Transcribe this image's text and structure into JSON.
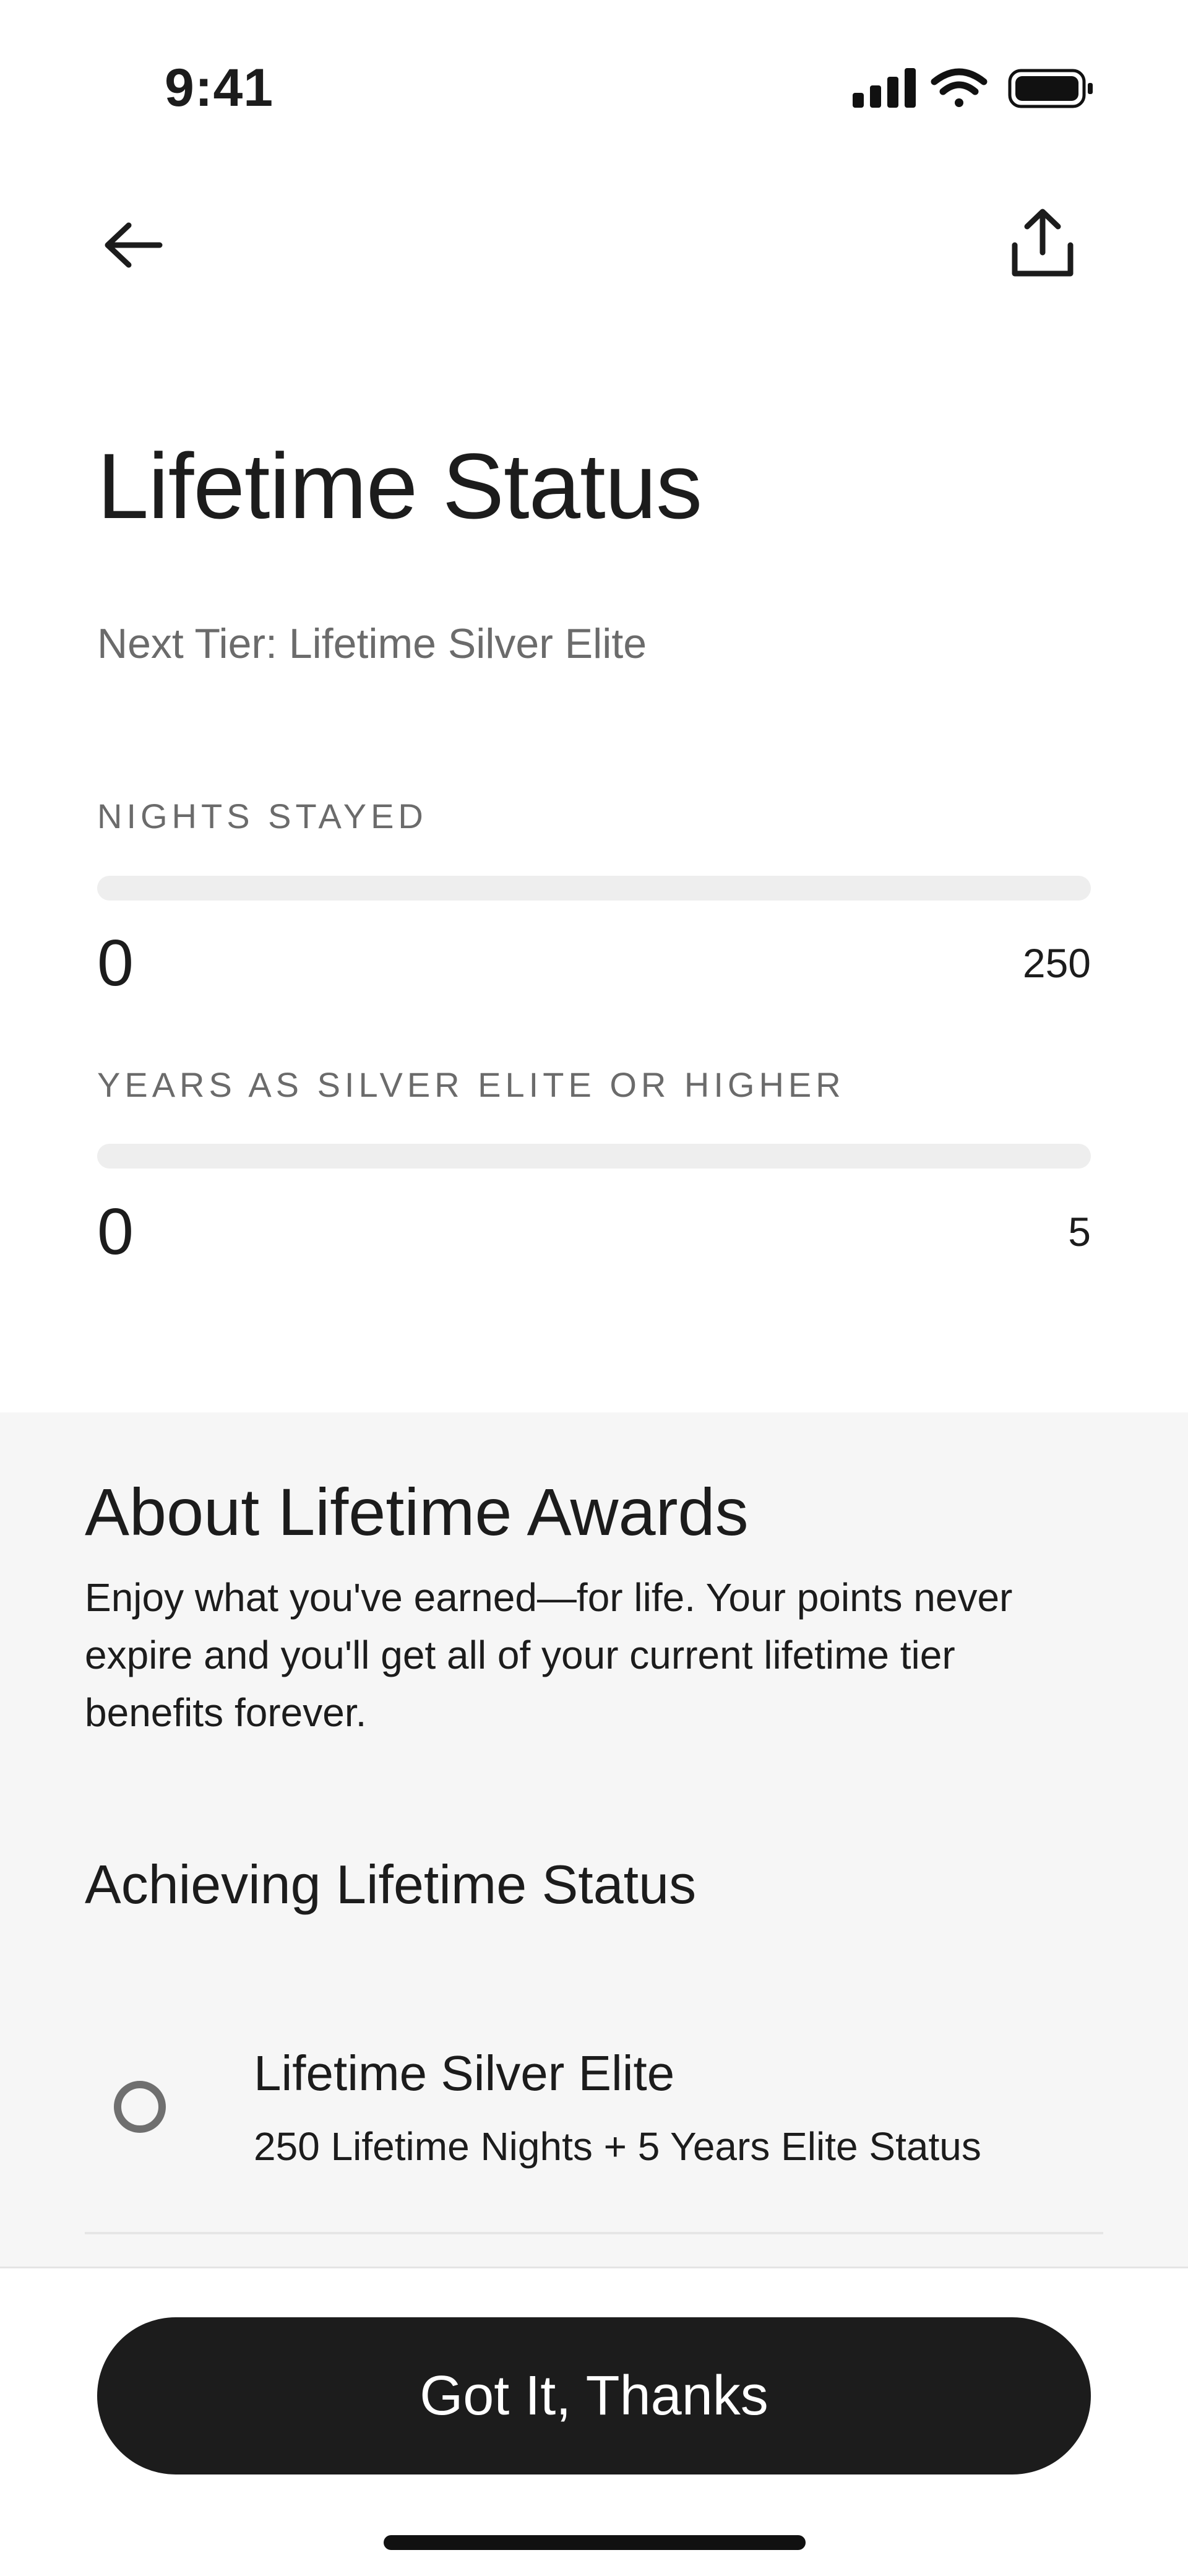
{
  "status_bar": {
    "time": "9:41",
    "icons": [
      "signal-icon",
      "wifi-icon",
      "battery-icon"
    ]
  },
  "nav": {
    "back_icon": "arrow-left-icon",
    "share_icon": "share-icon"
  },
  "header": {
    "title": "Lifetime Status",
    "next_tier": "Next Tier: Lifetime Silver Elite"
  },
  "metrics": [
    {
      "label": "NIGHTS STAYED",
      "current": "0",
      "target": "250",
      "progress": 0
    },
    {
      "label": "YEARS AS SILVER ELITE OR HIGHER",
      "current": "0",
      "target": "5",
      "progress": 0
    }
  ],
  "about": {
    "title": "About Lifetime Awards",
    "body": "Enjoy what you've earned—for life. Your points never expire and you'll get all of your current lifetime tier benefits forever."
  },
  "achieving": {
    "title": "Achieving Lifetime Status",
    "tiers": [
      {
        "name": "Lifetime Silver Elite",
        "requirement": "250 Lifetime Nights + 5 Years Elite Status",
        "achieved": false
      }
    ]
  },
  "footer": {
    "cta_label": "Got It, Thanks"
  },
  "colors": {
    "primary": "#1c1c1c",
    "muted_text": "#6b6b6b",
    "track": "#eeeeee",
    "section_bg": "#f6f6f6"
  }
}
